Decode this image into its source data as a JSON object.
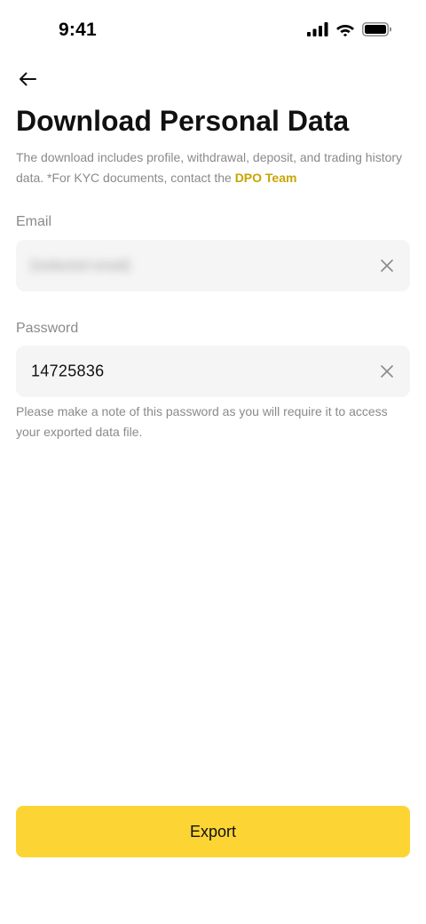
{
  "status_bar": {
    "time": "9:41"
  },
  "header": {
    "back_icon": "arrow-left-icon",
    "title": "Download Personal Data"
  },
  "description": {
    "text": "The download includes profile, withdrawal, deposit, and trading history data. *For KYC documents, contact the ",
    "link_label": "DPO Team"
  },
  "email": {
    "label": "Email",
    "value": "[redacted email]",
    "clear_icon": "close-icon"
  },
  "password": {
    "label": "Password",
    "value": "14725836",
    "clear_icon": "close-icon",
    "helper_text": "Please make a note of this password as you will require it to access your exported data file."
  },
  "footer": {
    "export_label": "Export"
  },
  "colors": {
    "accent": "#fcd535",
    "link": "#c9a400",
    "field_bg": "#f5f5f5",
    "muted_text": "#8a8a8a"
  }
}
